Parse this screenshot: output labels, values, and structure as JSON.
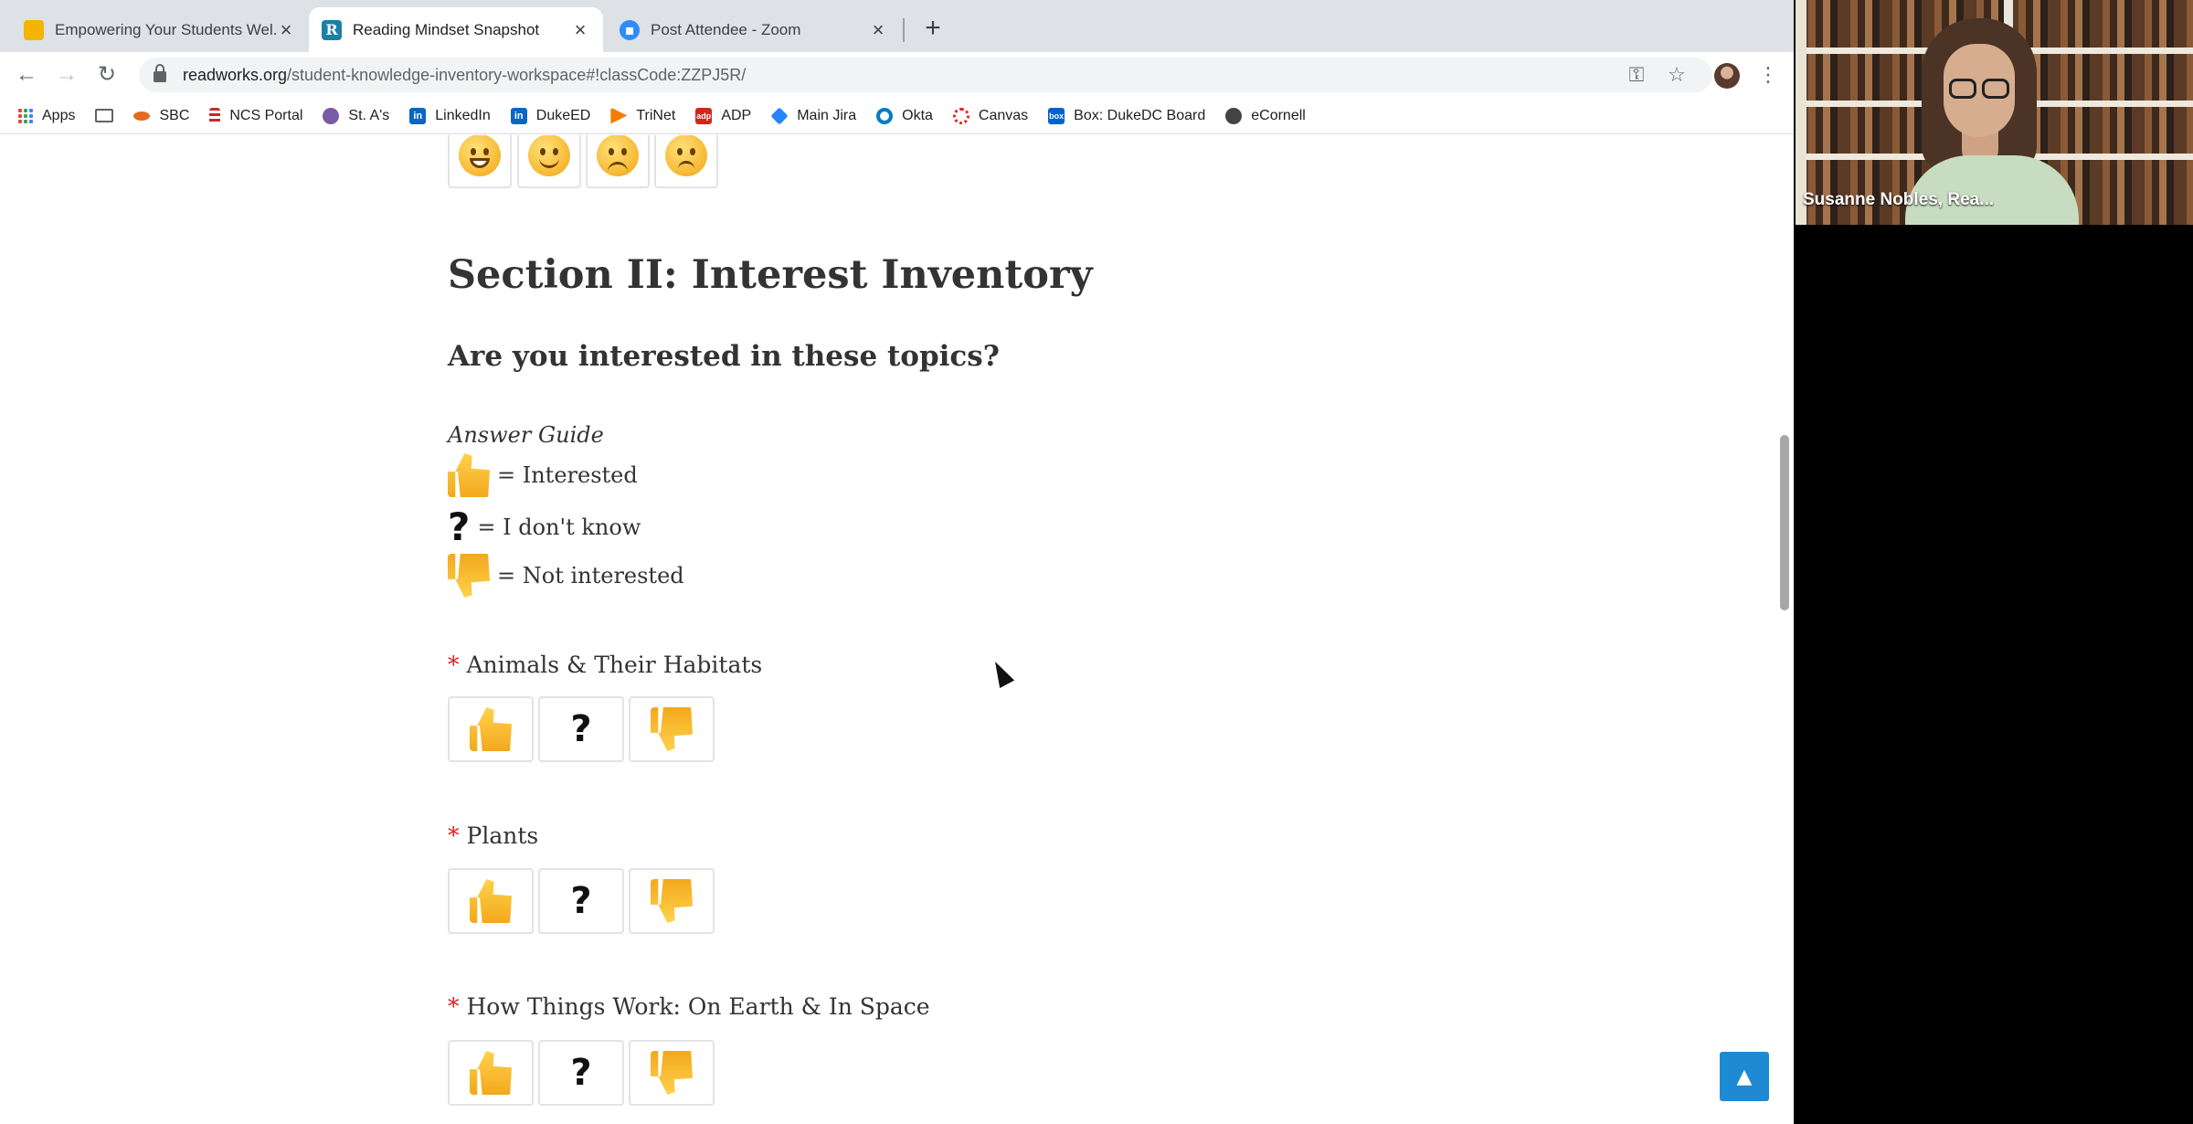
{
  "browser": {
    "tabs": [
      {
        "title": "Empowering Your Students Wel...",
        "close": "×"
      },
      {
        "title": "Reading Mindset Snapshot",
        "close": "×"
      },
      {
        "title": "Post Attendee - Zoom",
        "close": "×"
      }
    ],
    "new_tab": "+",
    "nav": {
      "back": "←",
      "forward": "→",
      "reload": "↻"
    },
    "url_host": "readworks.org",
    "url_path": "/student-knowledge-inventory-workspace#!classCode:ZZPJ5R/",
    "toolbar_icons": {
      "key": "⚿",
      "star": "☆",
      "menu": "⋮"
    },
    "bookmarks": [
      {
        "label": "Apps"
      },
      {
        "label": ""
      },
      {
        "label": "SBC"
      },
      {
        "label": "NCS Portal"
      },
      {
        "label": "St. A's"
      },
      {
        "label": "LinkedIn"
      },
      {
        "label": "DukeED"
      },
      {
        "label": "TriNet"
      },
      {
        "label": "ADP"
      },
      {
        "label": "Main Jira"
      },
      {
        "label": "Okta"
      },
      {
        "label": "Canvas"
      },
      {
        "label": "Box: DukeDC Board"
      },
      {
        "label": "eCornell"
      }
    ]
  },
  "page": {
    "section_title": "Section II: Interest Inventory",
    "question": "Are you interested in these topics?",
    "answer_guide": {
      "title": "Answer Guide",
      "interested": "= Interested",
      "dont_know": "= I don't know",
      "not_interested": "= Not interested",
      "question_mark": "?"
    },
    "required_mark": "*",
    "topics": [
      {
        "label": "Animals & Their Habitats"
      },
      {
        "label": "Plants"
      },
      {
        "label": "How Things Work: On Earth & In Space"
      }
    ],
    "scroll_top_label": "▲"
  },
  "zoom": {
    "participant_name": "Susanne Nobles, Rea..."
  },
  "colors": {
    "tab_strip": "#dee1e6",
    "required": "#dd2222",
    "scroll_top": "#1f8ad4"
  }
}
